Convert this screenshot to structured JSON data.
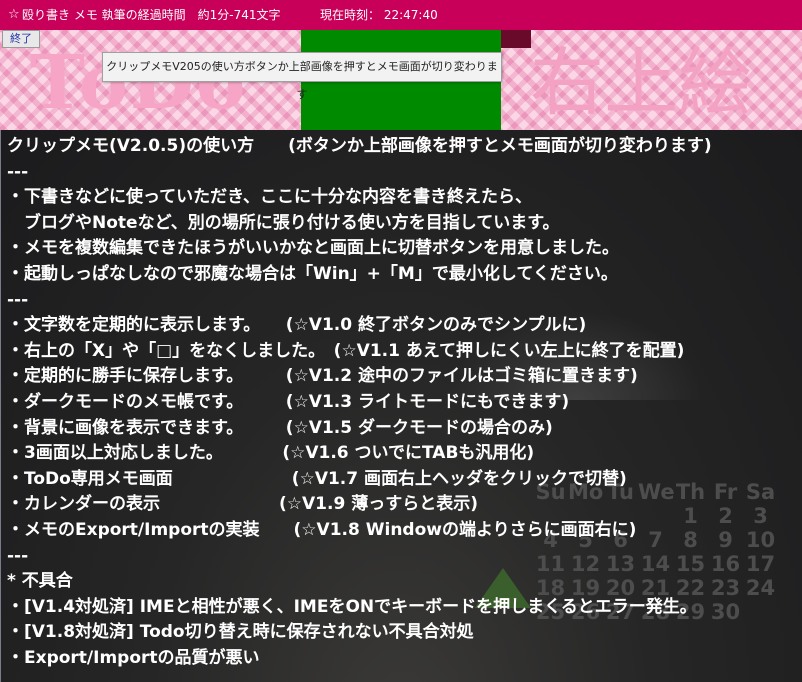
{
  "titlebar": {
    "icon_glyph": "☆",
    "title": "殴り書き メモ 執筆の経過時間　約1分-741文字",
    "clock": "現在時刻：  22:47:40"
  },
  "header": {
    "close_label": "終了",
    "todo_label": "ToDo",
    "right_label": "右上絵",
    "tooltip": "クリップメモV205の使い方ボタンか上部画像を押すとメモ画面が切り変わります"
  },
  "calendar": {
    "weekdays": [
      "Su",
      "Mo",
      "Tu",
      "We",
      "Th",
      "Fr",
      "Sa"
    ],
    "weeks": [
      [
        "",
        "",
        "",
        "",
        "1",
        "2",
        "3"
      ],
      [
        "4",
        "5",
        "6",
        "7",
        "8",
        "9",
        "10"
      ],
      [
        "11",
        "12",
        "13",
        "14",
        "15",
        "16",
        "17"
      ],
      [
        "18",
        "19",
        "20",
        "21",
        "22",
        "23",
        "24"
      ],
      [
        "25",
        "26",
        "27",
        "28",
        "29",
        "30",
        ""
      ]
    ]
  },
  "editor": {
    "lines": [
      "クリップメモ(V2.0.5)の使い方　　(ボタンか上部画像を押すとメモ画面が切り変わります)",
      "---",
      "・下書きなどに使っていただき、ここに十分な内容を書き終えたら、",
      "　ブログやNoteなど、別の場所に張り付ける使い方を目指しています。",
      "・メモを複数編集できたほうがいいかなと画面上に切替ボタンを用意しました。",
      "・起動しっぱなしなので邪魔な場合は「Win」+「M」で最小化してください。",
      "---",
      "・文字数を定期的に表示します。　　(☆V1.0 終了ボタンのみでシンプルに)",
      "・右上の「X」や「□」をなくしました。　(☆V1.1 あえて押しにくい左上に終了を配置)",
      "・定期的に勝手に保存します。　　　(☆V1.2 途中のファイルはゴミ箱に置きます)",
      "・ダークモードのメモ帳です。　　　(☆V1.3 ライトモードにもできます)",
      "・背景に画像を表示できます。　　　(☆V1.5 ダークモードの場合のみ)",
      "・3画面以上対応しました。　　　　(☆V1.6 ついでにTABも汎用化)",
      "・ToDo専用メモ画面　　　　　　　(☆V1.7 画面右上ヘッダをクリックで切替)",
      "・カレンダーの表示　　　　　　　(☆V1.9 薄っすらと表示)",
      "・メモのExport/Importの実装　　(☆V1.8 Windowの端よりさらに画面右に)",
      "---",
      "* 不具合",
      "・[V1.4対処済] IMEと相性が悪く、IMEをONでキーボードを押しまくるとエラー発生。",
      "・[V1.8対処済] Todo切り替え時に保存されない不具合対処",
      "・Export/Importの品質が悪い"
    ]
  }
}
